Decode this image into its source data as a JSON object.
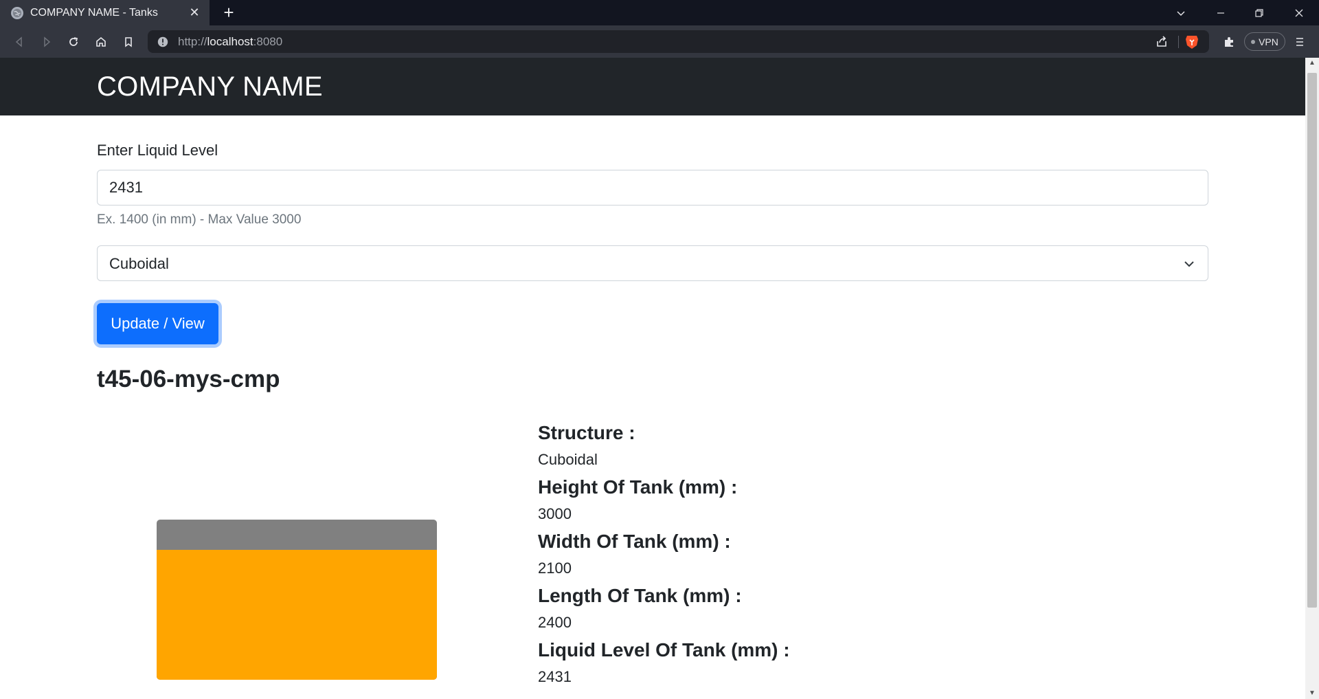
{
  "browser": {
    "tab_title": "COMPANY NAME - Tanks",
    "url_scheme": "http://",
    "url_host": "localhost",
    "url_port": ":8080",
    "vpn_label": "VPN"
  },
  "navbar": {
    "brand": "COMPANY NAME"
  },
  "form": {
    "level_label": "Enter Liquid Level",
    "level_value": "2431",
    "help_text": "Ex. 1400 (in mm) - Max Value 3000",
    "structure_selected": "Cuboidal",
    "update_button_label": "Update / View"
  },
  "tank": {
    "name": "t45-06-mys-cmp",
    "fill_fraction": 0.81,
    "colors": {
      "empty": "#808080",
      "liquid": "#ffa500"
    },
    "details": [
      {
        "label": "Structure :",
        "value": "Cuboidal"
      },
      {
        "label": "Height Of Tank (mm) :",
        "value": "3000"
      },
      {
        "label": "Width Of Tank (mm) :",
        "value": "2100"
      },
      {
        "label": "Length Of Tank (mm) :",
        "value": "2400"
      },
      {
        "label": "Liquid Level Of Tank (mm) :",
        "value": "2431"
      }
    ]
  },
  "icons": {
    "favicon": "globe-icon",
    "close": "close-icon",
    "new_tab": "plus-icon",
    "back": "back-arrow-icon",
    "forward": "forward-arrow-icon",
    "reload": "reload-icon",
    "home": "home-icon",
    "bookmark": "bookmark-icon",
    "site_info": "info-icon",
    "share": "share-icon",
    "brave": "brave-shield-icon",
    "extensions": "puzzle-icon",
    "menu": "hamburger-menu-icon",
    "select_chevron": "chevron-down-icon"
  }
}
